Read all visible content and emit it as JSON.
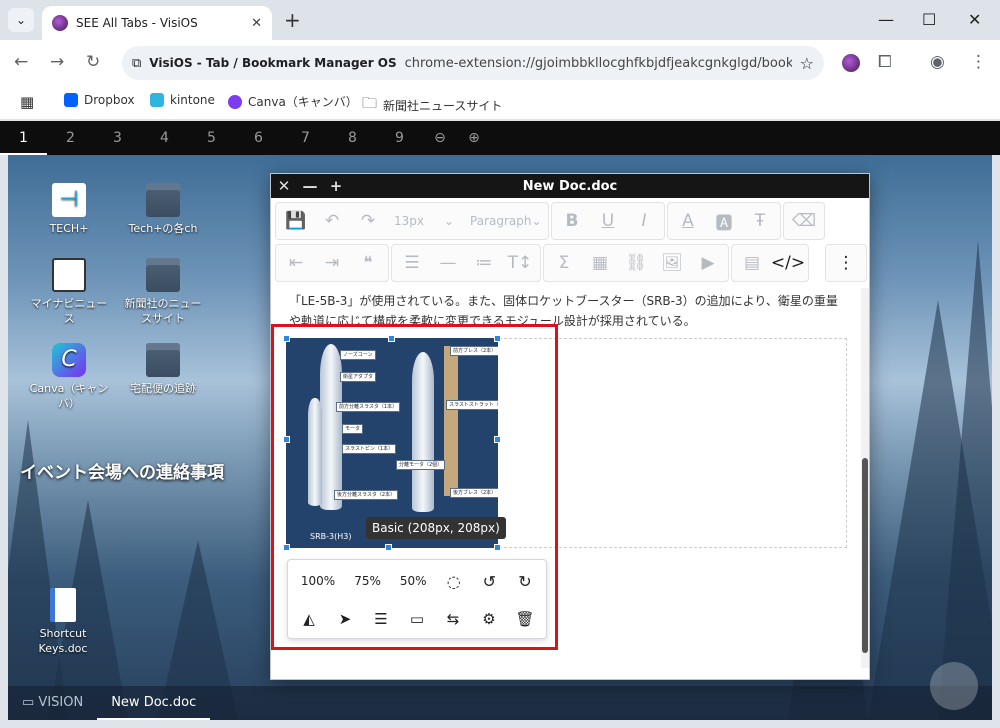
{
  "browser": {
    "tab_title": "SEE All Tabs - VisiOS",
    "new_tab_symbol": "+",
    "site_name": "VisiOS - Tab / Bookmark Manager OS",
    "url": "chrome-extension://gjoimbbkllocghfkbjdfjeakcgnkglgd/bookma...",
    "bookmarks": [
      {
        "label": "Dropbox"
      },
      {
        "label": "kintone"
      },
      {
        "label": "Canva（キャンバ）"
      },
      {
        "label": "新聞社ニュースサイト"
      }
    ]
  },
  "workspace_tabs": [
    "1",
    "2",
    "3",
    "4",
    "5",
    "6",
    "7",
    "8",
    "9"
  ],
  "active_workspace": "1",
  "desktop": {
    "icons": [
      {
        "label": "TECH+"
      },
      {
        "label": "Tech+の各ch"
      },
      {
        "label": "マイナビニュース"
      },
      {
        "label": "新聞社のニュースサイト"
      },
      {
        "label": "Canva（キャンバ）"
      },
      {
        "label": "宅配便の追跡"
      },
      {
        "label": "Shortcut Keys.doc"
      }
    ],
    "banner_text": "イベント会場への連絡事項"
  },
  "taskbar": {
    "items": [
      "VISION",
      "New Doc.doc"
    ]
  },
  "editor": {
    "title": "New Doc.doc",
    "font_size": "13px",
    "block_format": "Paragraph",
    "paragraph": "「LE-5B-3」が使用されている。また、固体ロケットブースター（SRB-3）の追加により、衛星の重量や軌道に応じて構成を柔軟に変更できるモジュール設計が採用されている。",
    "image_caption": "SRB-3(H3)",
    "image_labels": [
      "ノーズコーン",
      "衛星アダプタ",
      "前方分離スラスタ（1本）",
      "モータ",
      "スラストピン（1本）",
      "後方分離スラスタ（2本）",
      "前方ブレス（2本）",
      "スラストストラット（2本）",
      "分離モータ（2個）",
      "後方ブレス（2本）"
    ],
    "size_tooltip": "Basic (208px, 208px)",
    "image_toolbar": {
      "zoom_options": [
        "100%",
        "75%",
        "50%"
      ]
    }
  }
}
